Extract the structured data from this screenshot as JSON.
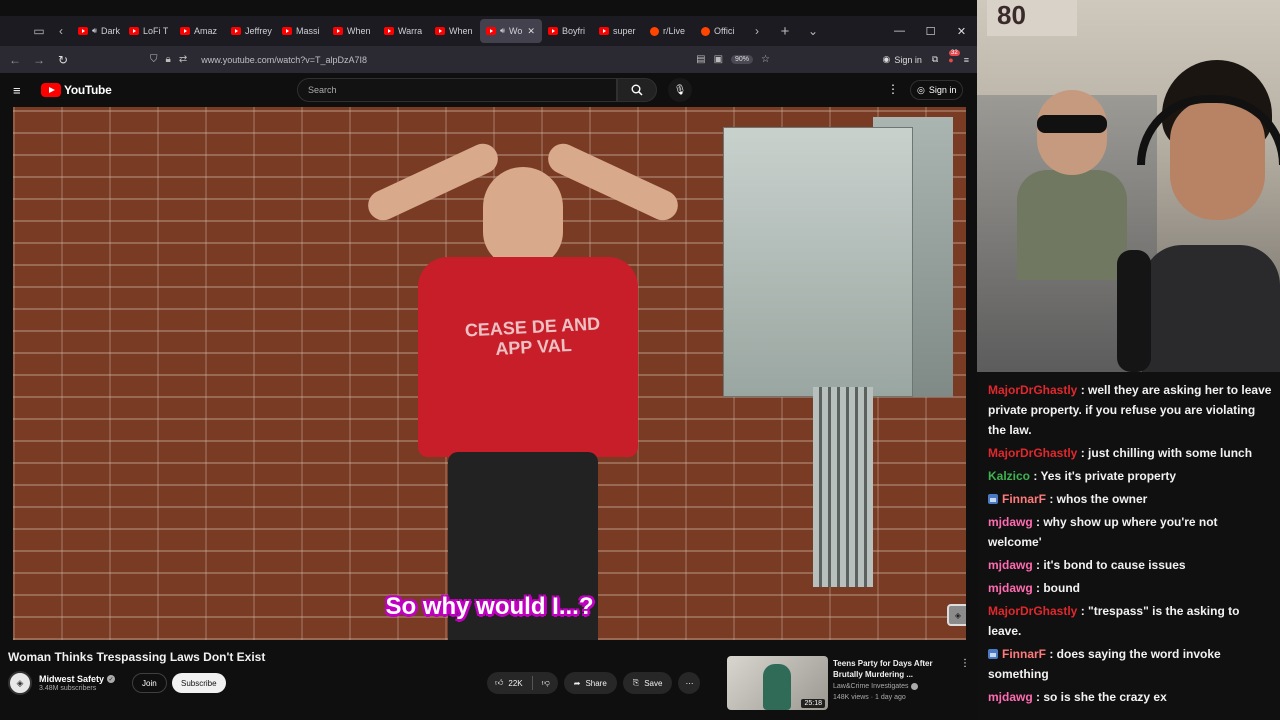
{
  "browser": {
    "tabs": [
      {
        "label": "Dark S",
        "icon": "youtube-icon",
        "audio": true,
        "active": false
      },
      {
        "label": "LoFi T",
        "icon": "youtube-icon",
        "audio": false,
        "active": false
      },
      {
        "label": "Amaz",
        "icon": "youtube-icon",
        "audio": false,
        "active": false
      },
      {
        "label": "Jeffrey",
        "icon": "youtube-icon",
        "audio": false,
        "active": false
      },
      {
        "label": "Massi",
        "icon": "youtube-icon",
        "audio": false,
        "active": false
      },
      {
        "label": "When",
        "icon": "youtube-icon",
        "audio": false,
        "active": false
      },
      {
        "label": "Warra",
        "icon": "youtube-icon",
        "audio": false,
        "active": false
      },
      {
        "label": "When",
        "icon": "youtube-icon",
        "audio": false,
        "active": false
      },
      {
        "label": "Wo",
        "icon": "youtube-icon",
        "audio": true,
        "active": true
      },
      {
        "label": "Boyfri",
        "icon": "youtube-icon",
        "audio": false,
        "active": false
      },
      {
        "label": "super",
        "icon": "youtube-icon",
        "audio": false,
        "active": false
      },
      {
        "label": "r/Live",
        "icon": "reddit-icon",
        "audio": false,
        "active": false
      },
      {
        "label": "Offici",
        "icon": "reddit-icon",
        "audio": false,
        "active": false
      }
    ],
    "url": "www.youtube.com/watch?v=T_alpDzA7I8",
    "zoom": "90%",
    "signin_label": "Sign in",
    "notification_count": "32"
  },
  "youtube": {
    "logo_text": "YouTube",
    "search_placeholder": "Search",
    "signin_label": "Sign in",
    "video": {
      "caption": "So why would I...?",
      "shirt_text": "CEASE DE AND APP VAL"
    },
    "title": "Woman Thinks Trespassing Laws Don't Exist",
    "channel": {
      "name": "Midwest Safety",
      "subscribers": "3.48M subscribers",
      "join_label": "Join",
      "subscribe_label": "Subscribe"
    },
    "actions": {
      "likes": "22K",
      "share_label": "Share",
      "save_label": "Save"
    },
    "recommendation": {
      "title": "Teens Party for Days After Brutally Murdering ...",
      "channel": "Law&Crime Investigates",
      "meta": "148K views · 1 day ago",
      "duration": "25:18"
    }
  },
  "webcam": {
    "sign_text": "80"
  },
  "chat": {
    "messages": [
      {
        "user": "MajorDrGhastly",
        "color": "#e0282d",
        "badge": false,
        "text": "well they are asking her to leave private property. if you refuse you are violating the law."
      },
      {
        "user": "MajorDrGhastly",
        "color": "#e0282d",
        "badge": false,
        "text": "just chilling with some lunch"
      },
      {
        "user": "Kalzico",
        "color": "#3fb34f",
        "badge": false,
        "text": "Yes it's private property"
      },
      {
        "user": "FinnarF",
        "color": "#ff7a7a",
        "badge": true,
        "text": "whos the owner"
      },
      {
        "user": "mjdawg",
        "color": "#ff6bb0",
        "badge": false,
        "text": "why show up where you're not welcome'"
      },
      {
        "user": "mjdawg",
        "color": "#ff6bb0",
        "badge": false,
        "text": "it's bond to cause issues"
      },
      {
        "user": "mjdawg",
        "color": "#ff6bb0",
        "badge": false,
        "text": "bound"
      },
      {
        "user": "MajorDrGhastly",
        "color": "#e0282d",
        "badge": false,
        "text": "\"trespass\" is the asking to leave."
      },
      {
        "user": "FinnarF",
        "color": "#ff7a7a",
        "badge": true,
        "text": "does saying the word invoke something"
      },
      {
        "user": "mjdawg",
        "color": "#ff6bb0",
        "badge": false,
        "text": "so is she the crazy ex"
      }
    ]
  }
}
